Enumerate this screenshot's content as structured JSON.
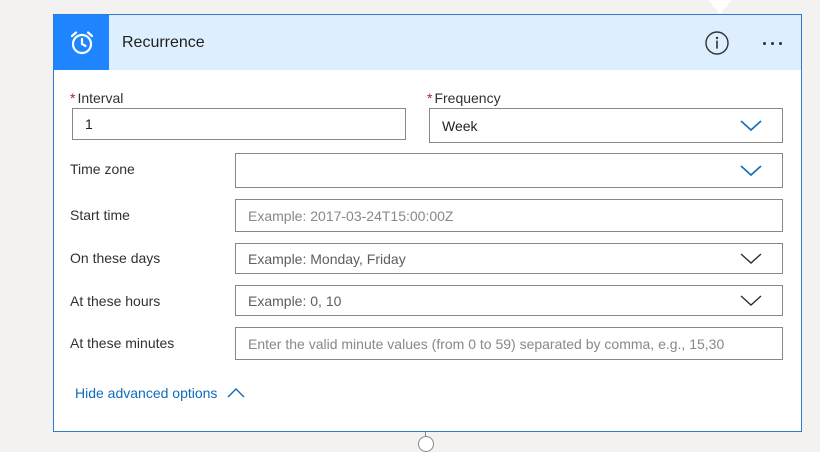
{
  "card": {
    "title": "Recurrence",
    "title_icon": "alarm-clock-icon",
    "info_icon": "info-icon",
    "more_icon": "ellipsis-icon"
  },
  "fields": {
    "interval": {
      "label": "Interval",
      "required": "*",
      "value": "1"
    },
    "frequency": {
      "label": "Frequency",
      "required": "*",
      "value": "Week"
    },
    "time_zone": {
      "label": "Time zone",
      "value": ""
    },
    "start_time": {
      "label": "Start time",
      "placeholder": "Example: 2017-03-24T15:00:00Z"
    },
    "on_these_days": {
      "label": "On these days",
      "placeholder": "Example: Monday, Friday"
    },
    "at_these_hours": {
      "label": "At these hours",
      "placeholder": "Example: 0, 10"
    },
    "at_these_minutes": {
      "label": "At these minutes",
      "placeholder": "Enter the valid minute values (from 0 to 59) separated by comma, e.g., 15,30"
    }
  },
  "advanced": {
    "label": "Hide advanced options"
  },
  "colors": {
    "accent": "#1f85ff",
    "header_bg": "#ddeeff",
    "border": "#2b7cd3",
    "link": "#0f6cbd",
    "required": "#a4262c"
  }
}
